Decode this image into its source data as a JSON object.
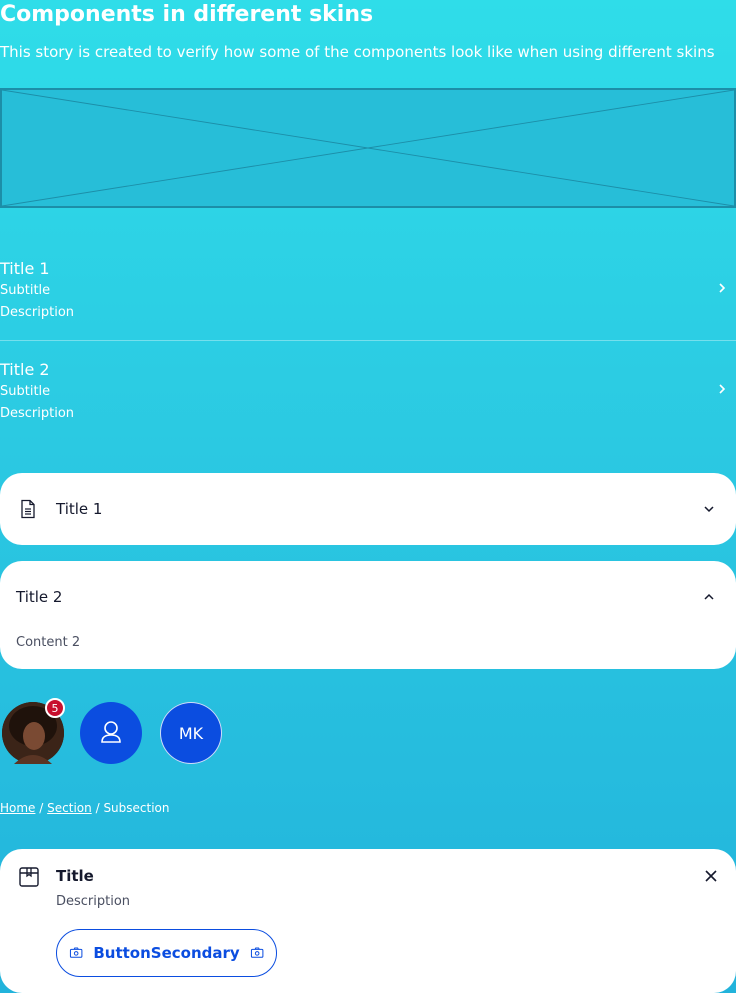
{
  "header": {
    "title": "Components in different skins",
    "subtitle": "This story is created to verify how some of the components look like when using different skins"
  },
  "list": [
    {
      "title": "Title 1",
      "subtitle": "Subtitle",
      "description": "Description"
    },
    {
      "title": "Title 2",
      "subtitle": "Subtitle",
      "description": "Description"
    }
  ],
  "accordions": [
    {
      "title": "Title 1",
      "state": "collapsed"
    },
    {
      "title": "Title 2",
      "state": "expanded",
      "content": "Content 2"
    }
  ],
  "avatars": {
    "badge_count": "5",
    "initials": "MK"
  },
  "breadcrumb": {
    "items": [
      "Home",
      "Section",
      "Subsection"
    ],
    "separator": "/"
  },
  "callout": {
    "title": "Title",
    "description": "Description",
    "button_label": "ButtonSecondary"
  },
  "colors": {
    "brand": "#0b4de0",
    "badge": "#c8102e",
    "background_top": "#2fdde9",
    "background_bottom": "#22b3db"
  }
}
